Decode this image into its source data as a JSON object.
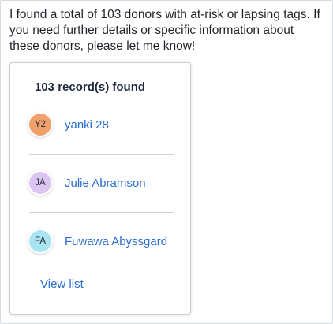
{
  "message": {
    "line1": "I found a total of 103 donors with at-risk or lapsing tags. If",
    "line2": "you need further details or specific information about",
    "line3": "these donors, please let me know!"
  },
  "card": {
    "title": "103 record(s) found",
    "records": [
      {
        "initials": "Y2",
        "name": "yanki 28",
        "avatar_color": "#f0a06a"
      },
      {
        "initials": "JA",
        "name": "Julie Abramson",
        "avatar_color": "#dcc5f2"
      },
      {
        "initials": "FA",
        "name": "Fuwawa Abyssgard",
        "avatar_color": "#a8e4f2"
      }
    ],
    "view_list_label": "View list"
  },
  "colors": {
    "link": "#2a6fcf",
    "title": "#1e2a3c",
    "divider": "#cfd3d9"
  }
}
